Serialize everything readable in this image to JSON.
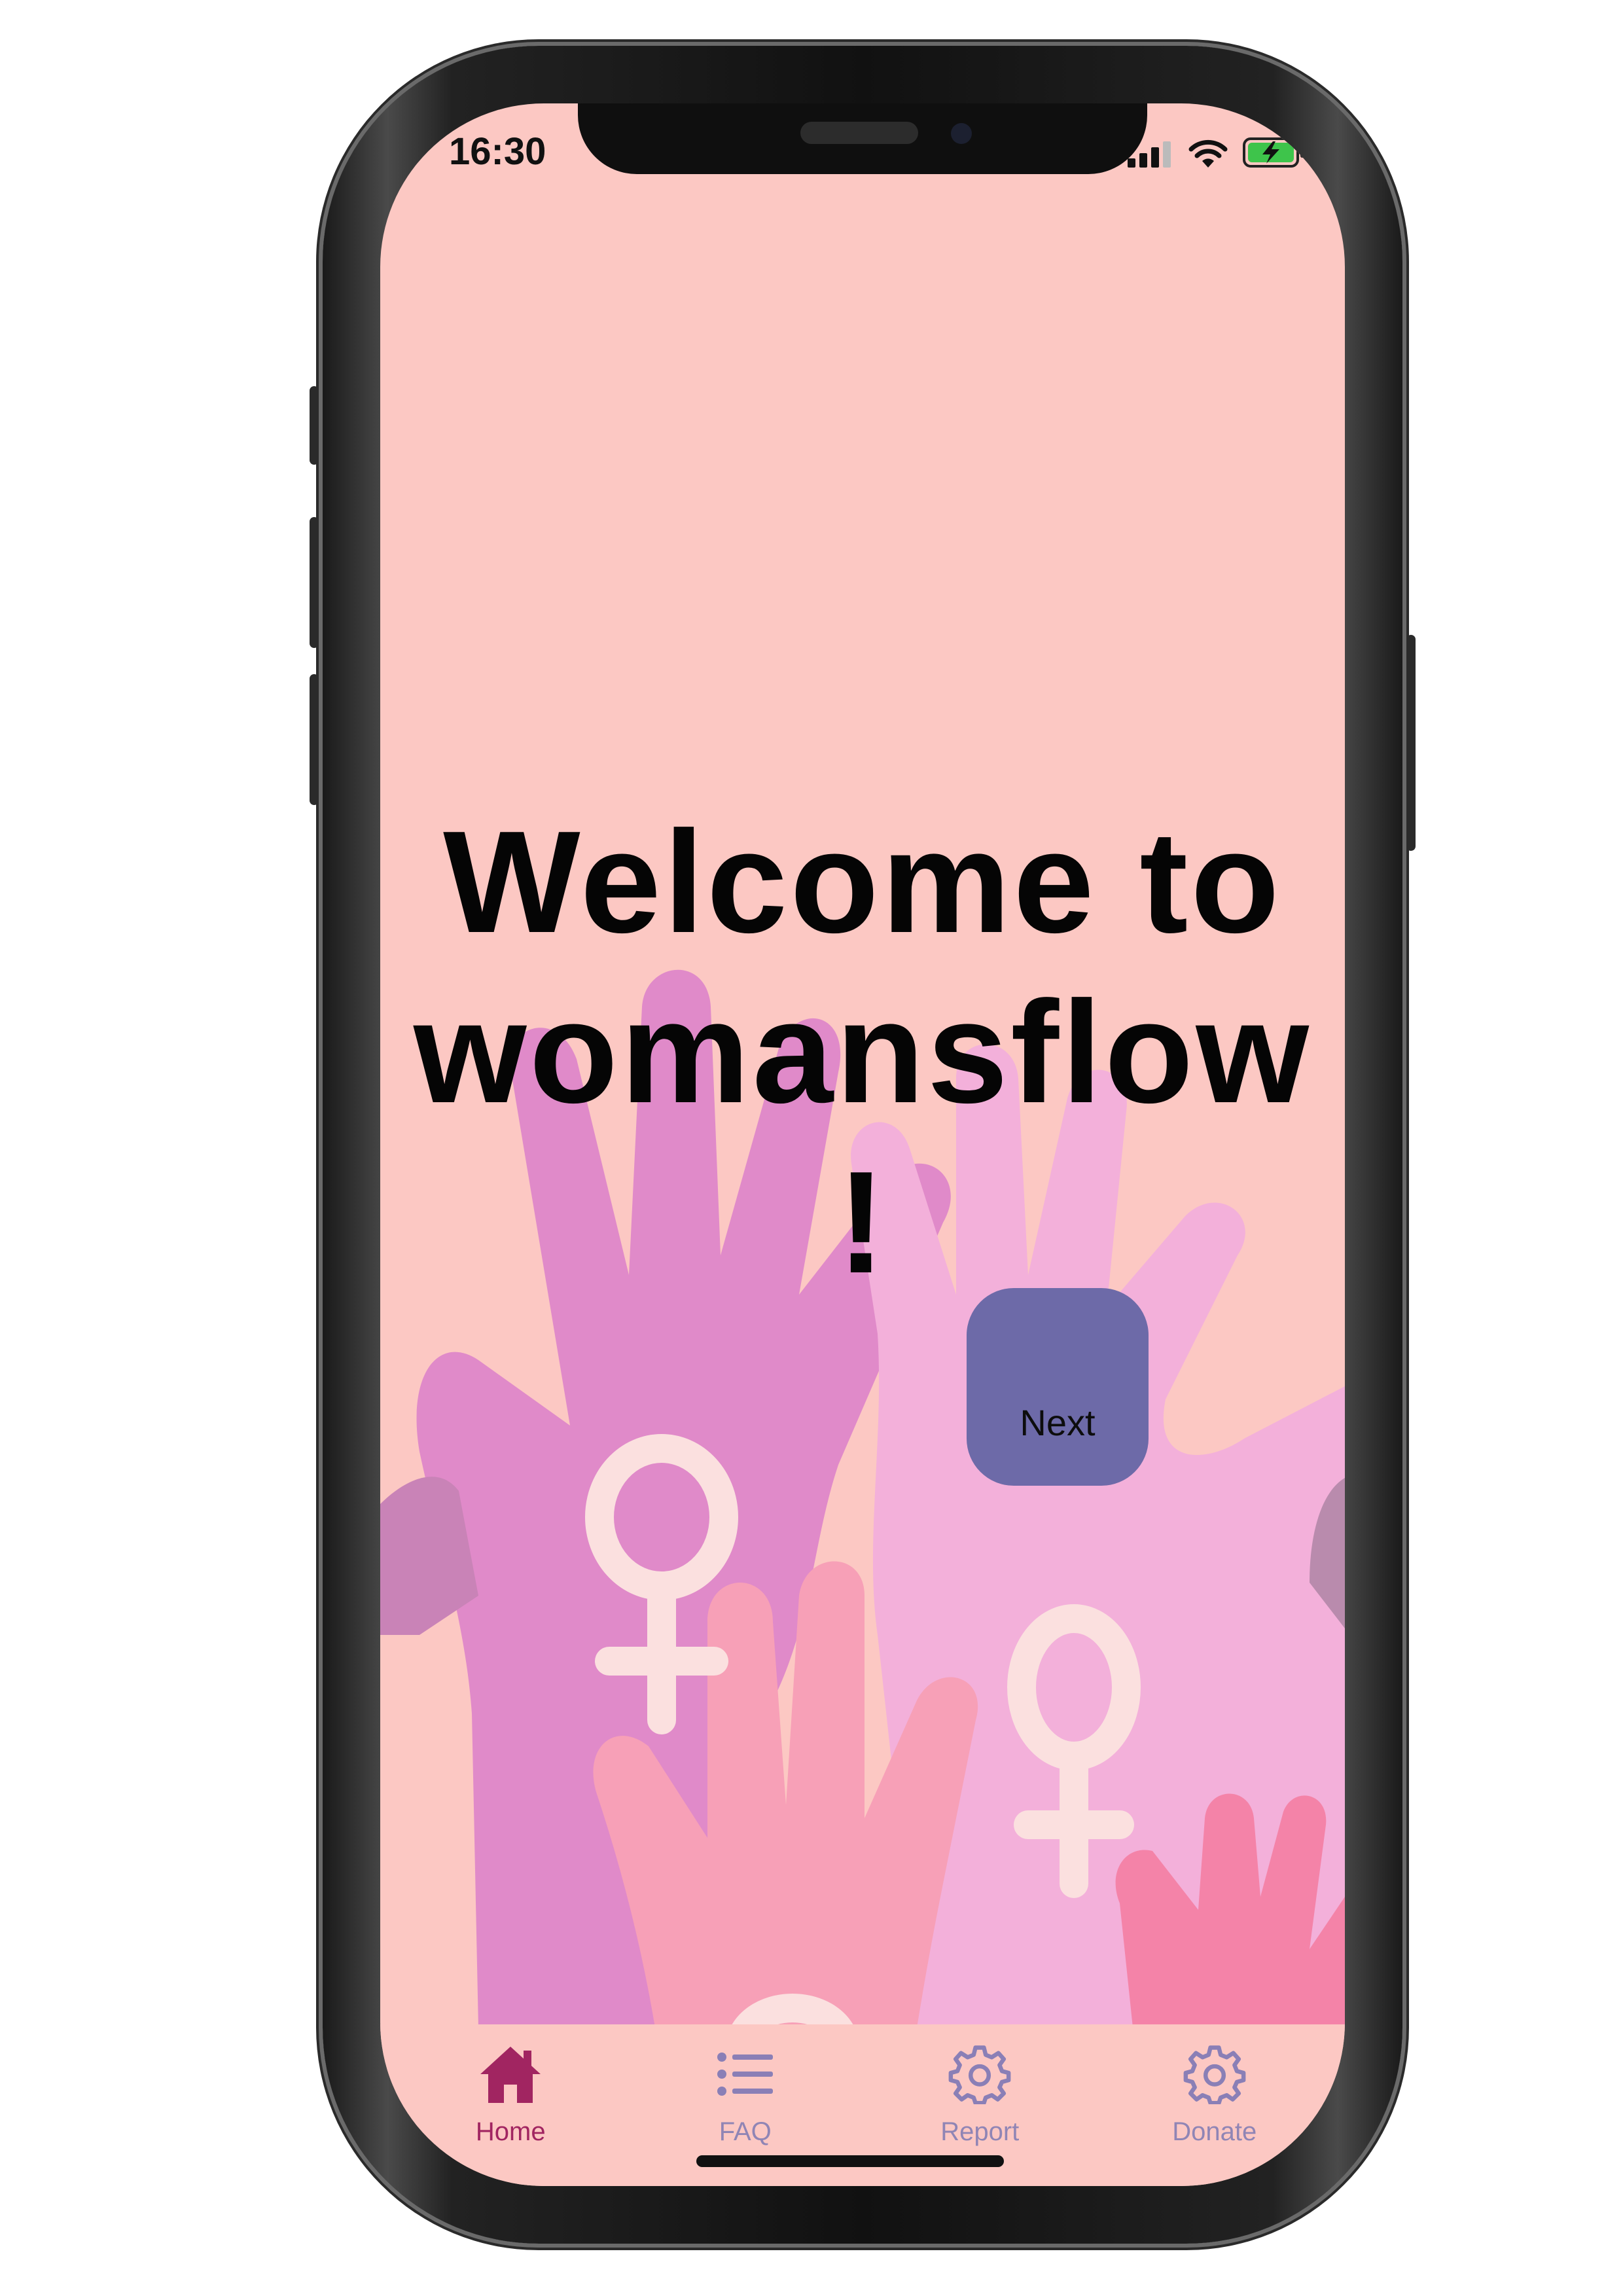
{
  "status_bar": {
    "time": "16:30",
    "icons": [
      "signal-icon",
      "wifi-icon",
      "battery-charging-icon"
    ]
  },
  "main": {
    "welcome_line1": "Welcome to",
    "welcome_line2": "womansflow",
    "welcome_line3": "!",
    "next_label": "Next"
  },
  "tabbar": {
    "tabs": [
      {
        "label": "Home",
        "icon": "home-icon",
        "active": true
      },
      {
        "label": "FAQ",
        "icon": "list-icon",
        "active": false
      },
      {
        "label": "Report",
        "icon": "gear-icon",
        "active": false
      },
      {
        "label": "Donate",
        "icon": "gear-icon",
        "active": false
      }
    ]
  },
  "colors": {
    "background": "#fcc8c3",
    "button": "#6d6aa8",
    "active_tab": "#a12561",
    "inactive_tab": "#9085b5"
  }
}
